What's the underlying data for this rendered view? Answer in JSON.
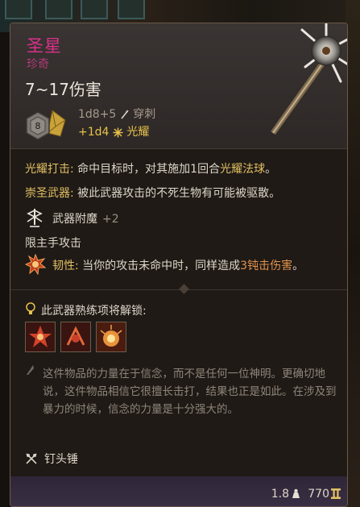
{
  "item": {
    "name": "圣星",
    "rarity": "珍奇",
    "damage_range": "7~17伤害",
    "damage_primary": "1d8+5",
    "damage_primary_type": "穿刺",
    "damage_secondary": "+1d4",
    "damage_secondary_type": "光耀",
    "dice_label": "8"
  },
  "effects": {
    "radiant_strike_title": "光耀打击:",
    "radiant_strike_text_a": " 命中目标时，对其施加1回合",
    "radiant_strike_highlight": "光耀法球",
    "radiant_strike_text_b": "。",
    "holy_weapon_title": "崇圣武器:",
    "holy_weapon_text": " 被此武器攻击的不死生物有可能被驱散。",
    "enchant_label": "武器附魔",
    "enchant_value": "+2",
    "main_hand_only": "限主手攻击",
    "resilience_title": "韧性:",
    "resilience_text_a": " 当你的攻击未命中时，同样造成",
    "resilience_highlight": "3钝击伤害",
    "resilience_text_b": "。"
  },
  "proficiency": {
    "label": "此武器熟练项将解锁:"
  },
  "lore": "这件物品的力量在于信念，而不是任何一位神明。更确切地说，这件物品相信它很擅长击打，结果也正是如此。在涉及到暴力的时候，信念的力量是十分强大的。",
  "weapon_type": "钉头锤",
  "footer": {
    "weight": "1.8",
    "price": "770"
  },
  "colors": {
    "name": "#d8318a",
    "rarity": "#b03a78",
    "radiant": "#e8c44a",
    "highlight": "#e2c063",
    "blunt": "#e0924e"
  }
}
